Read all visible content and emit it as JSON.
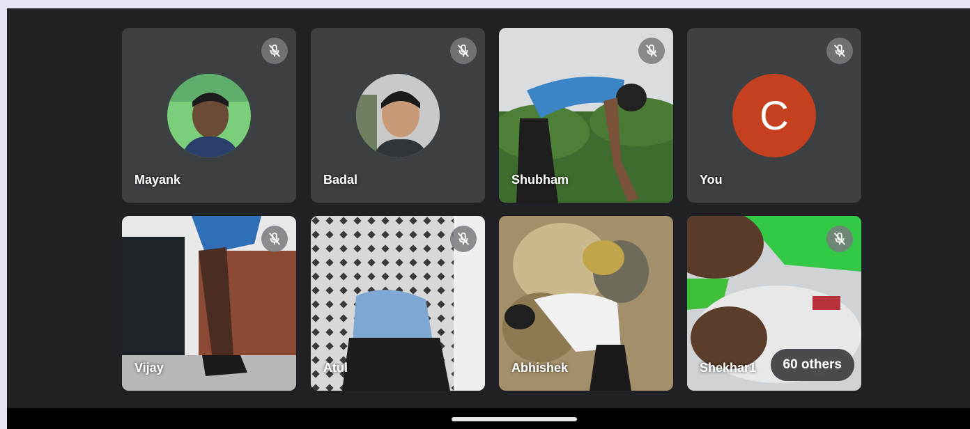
{
  "participants": [
    {
      "name": "Mayank",
      "avatar": "photo-avatar",
      "muted": true
    },
    {
      "name": "Badal",
      "avatar": "photo-avatar",
      "muted": true
    },
    {
      "name": "Shubham",
      "video": true,
      "muted": true
    },
    {
      "name": "You",
      "avatar_letter": "C",
      "muted": true
    },
    {
      "name": "Vijay",
      "video": true,
      "muted": true
    },
    {
      "name": "Atul",
      "video": true,
      "muted": true
    },
    {
      "name": "Abhishek",
      "video": true,
      "muted": false
    },
    {
      "name": "Shekhar1",
      "video": true,
      "muted": true
    }
  ],
  "others_label": "60 others",
  "colors": {
    "background": "#202124",
    "tile": "#3c4043",
    "you_avatar": "#c5401f",
    "mute_badge": "#787a7e"
  },
  "icons": {
    "mute": "mic-off-icon"
  }
}
